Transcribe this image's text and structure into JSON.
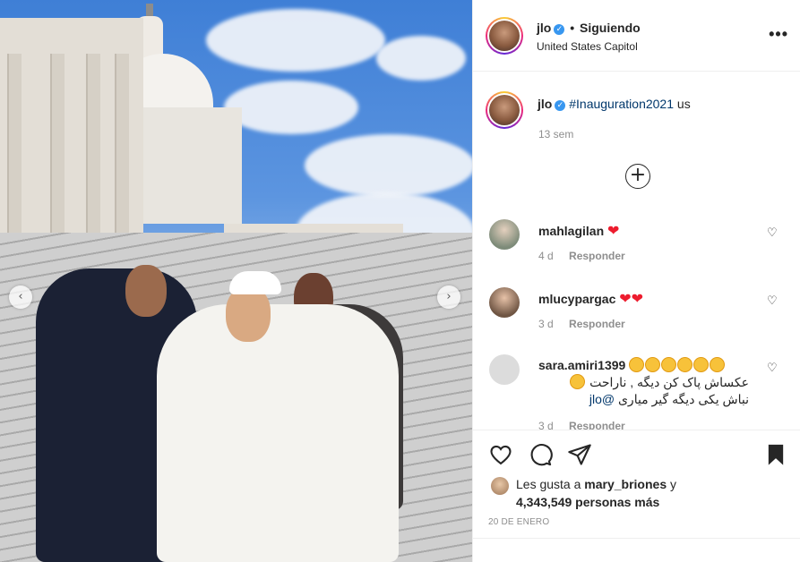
{
  "post": {
    "username": "jlo",
    "follow_status": "Siguiendo",
    "location": "United States Capitol",
    "more_label": "•••"
  },
  "caption": {
    "username": "jlo",
    "hashtag": "#Inauguration2021",
    "suffix": "us",
    "time": "13 sem"
  },
  "carousel": {
    "prev": "‹",
    "next": "›"
  },
  "load_more": "+",
  "comments": [
    {
      "username": "mahlagilan",
      "time": "4 d",
      "reply": "Responder"
    },
    {
      "username": "mlucypargac",
      "time": "3 d",
      "reply": "Responder"
    },
    {
      "username": "sara.amiri1399",
      "line1": "عکساش پاک کن دیگه , ناراحت",
      "line2": "نباش یکی دیگه گیر میاری",
      "mention": "@jlo",
      "time": "3 d",
      "reply": "Responder"
    }
  ],
  "likes": {
    "prefix": "Les gusta a",
    "user": "mary_briones",
    "conj": "y",
    "count": "4,343,549 personas más"
  },
  "date": "20 DE ENERO",
  "colors": {
    "verified": "#3897f0",
    "link": "#00376b",
    "heart": "#ed1c2e",
    "muted": "#8e8e8e"
  },
  "icons": [
    "verified-badge-icon",
    "more-options-icon",
    "plus-circle-icon",
    "heart-icon",
    "comment-icon",
    "share-icon",
    "bookmark-icon"
  ]
}
